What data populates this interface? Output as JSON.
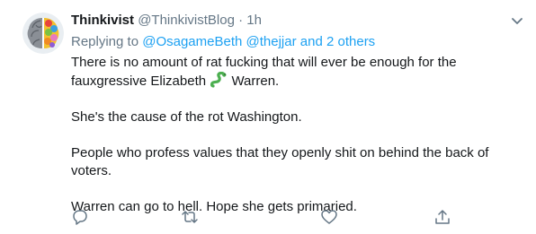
{
  "tweet": {
    "author": {
      "display_name": "Thinkivist",
      "handle": "@ThinkivistBlog",
      "separator": "·",
      "time": "1h",
      "avatar_icon": "brain-avatar"
    },
    "reply": {
      "prefix": "Replying to",
      "mentions": [
        "@OsagameBeth",
        "@thejjar"
      ],
      "conjunction": "and",
      "others": "2 others"
    },
    "body": {
      "line1_before_emoji": "There is no amount of rat fucking that will ever be enough for the fauxgressive Elizabeth",
      "emoji": "snake-icon",
      "line1_after_emoji": "Warren.",
      "para2": "She's the cause of the rot Washington.",
      "para3": "People who profess values that they openly shit on behind the back of voters.",
      "para4": "Warren can go to hell. Hope she gets primaried."
    },
    "actions": [
      "reply-icon",
      "retweet-icon",
      "like-icon",
      "share-icon"
    ],
    "colors": {
      "text": "#14171a",
      "muted": "#657786",
      "link": "#1da1f2",
      "snake": "#4caf50"
    }
  }
}
